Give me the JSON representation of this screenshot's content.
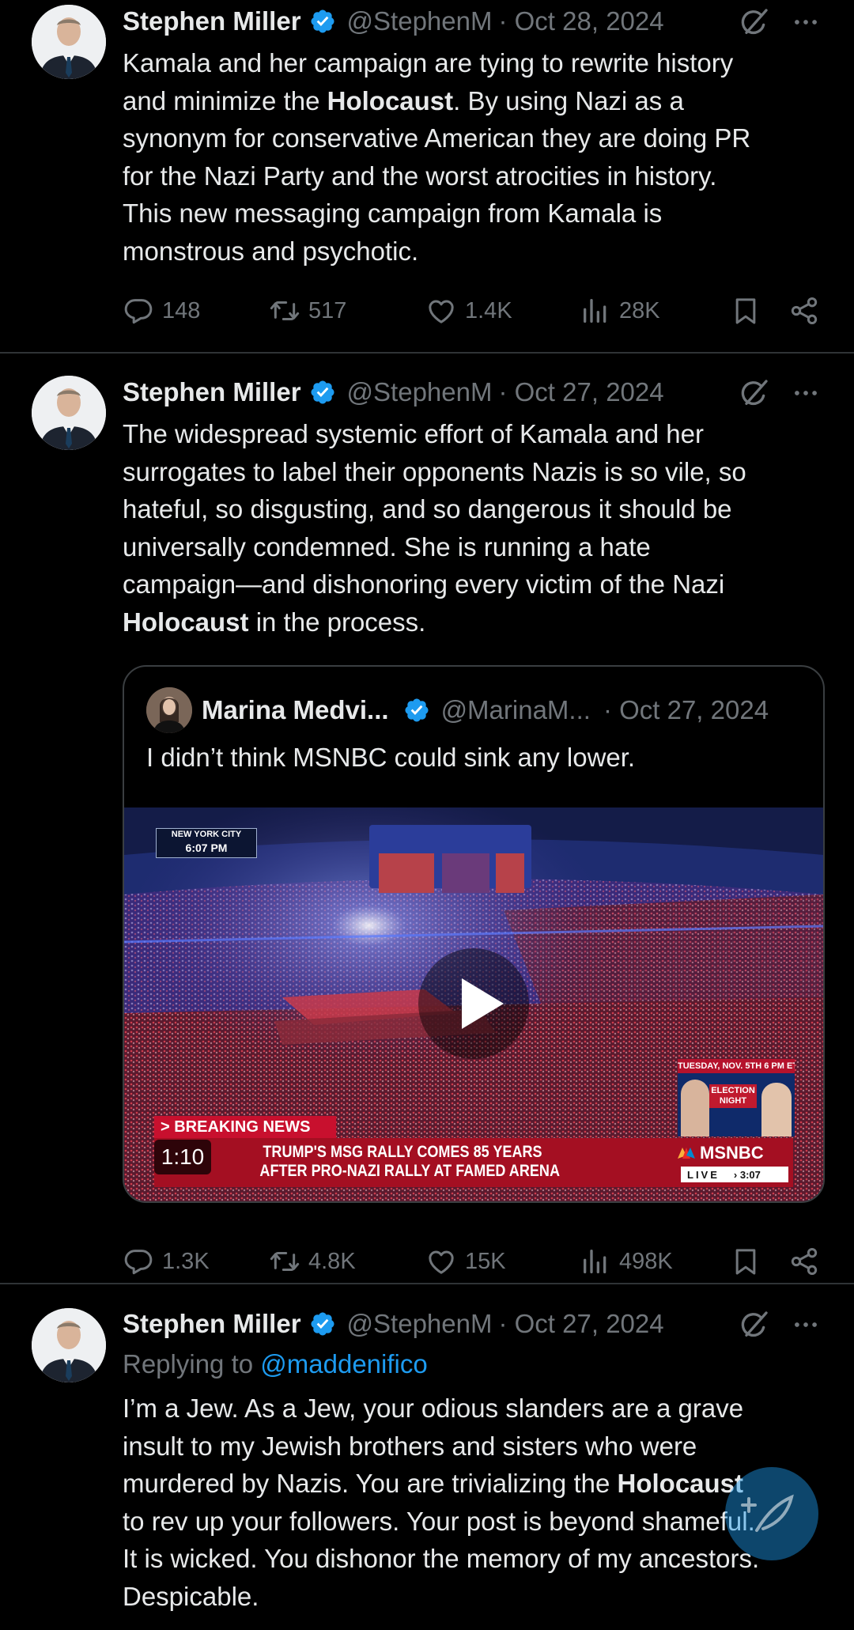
{
  "colors": {
    "background": "#000000",
    "text": "#e7e9ea",
    "muted": "#71767b",
    "link": "#1d9bf0",
    "verified": "#1d9bf0"
  },
  "tweets": [
    {
      "name": "Stephen Miller",
      "handle": "@StephenM",
      "date": "· Oct 28, 2024",
      "body_parts": [
        "Kamala and her campaign are tying to rewrite history\nand minimize the ",
        "Holocaust",
        ". By using Nazi as a\nsynonym for conservative American they are doing PR\nfor the Nazi Party and the worst atrocities in history.\nThis new messaging campaign from Kamala is\nmonstrous and psychotic."
      ],
      "replies": "148",
      "reposts": "517",
      "likes": "1.4K",
      "views": "28K"
    },
    {
      "name": "Stephen Miller",
      "handle": "@StephenM",
      "date": "· Oct 27, 2024",
      "body_parts": [
        "The widespread systemic effort of Kamala and her\nsurrogates to label their opponents Nazis is so vile, so\nhateful, so disgusting, and so dangerous it should be\nuniversally condemned. She is running a hate\ncampaign—and dishonoring every victim of the Nazi\n",
        "Holocaust",
        " in the process."
      ],
      "quote": {
        "name": "Marina Medvi...",
        "handle": "@MarinaM...",
        "date": "· Oct 27, 2024",
        "text": "I didn’t think MSNBC could sink any lower.",
        "video": {
          "duration": "1:10",
          "location": "NEW YORK CITY",
          "time": "6:07 PM",
          "breaking": "> BREAKING NEWS",
          "headline_1": "TRUMP'S MSG RALLY COMES 85 YEARS",
          "headline_2": "AFTER PRO-NAZI RALLY AT FAMED ARENA",
          "network": "MSNBC",
          "live": "LIVE",
          "live_time": "› 3:07",
          "promo_date": "TUESDAY, NOV. 5TH 6 PM ET",
          "promo_title": "ELECTION NIGHT"
        }
      },
      "replies": "1.3K",
      "reposts": "4.8K",
      "likes": "15K",
      "views": "498K"
    },
    {
      "name": "Stephen Miller",
      "handle": "@StephenM",
      "date": "· Oct 27, 2024",
      "reply_prefix": "Replying to ",
      "reply_to": "@maddenifico",
      "body_parts": [
        "I’m a Jew. As a Jew, your odious slanders are a grave\ninsult to my Jewish brothers and sisters who were\nmurdered by Nazis. You are trivializing the ",
        "Holocaust",
        "\nto rev up your followers. Your post is beyond shameful.\nIt is wicked. You dishonor the memory of my ancestors.\nDespicable."
      ]
    }
  ]
}
